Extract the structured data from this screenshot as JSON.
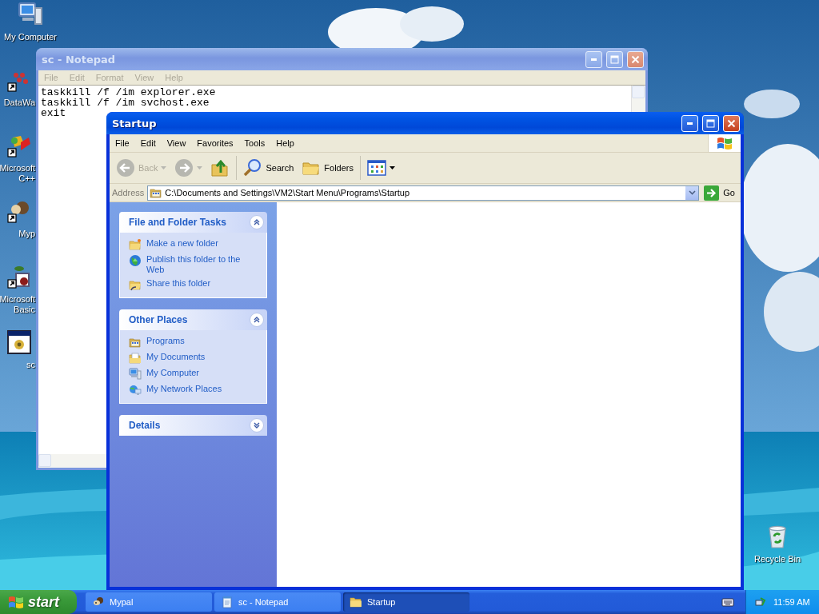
{
  "desktop_icons": [
    {
      "kind": "computer",
      "lines": [
        "My Computer"
      ]
    },
    {
      "kind": "app",
      "lines": [
        "DataWa"
      ]
    },
    {
      "kind": "ide",
      "lines": [
        "Microsoft",
        "C++"
      ]
    },
    {
      "kind": "browser",
      "lines": [
        "Myp"
      ]
    },
    {
      "kind": "basic",
      "lines": [
        "Microsoft",
        "Basic"
      ]
    },
    {
      "kind": "script",
      "lines": [
        "sc"
      ]
    }
  ],
  "recycle_bin": {
    "label": "Recycle Bin"
  },
  "notepad": {
    "title": "sc - Notepad",
    "active": false,
    "menu": [
      "File",
      "Edit",
      "Format",
      "View",
      "Help"
    ],
    "lines": [
      "taskkill /f /im explorer.exe",
      "taskkill /f /im svchost.exe",
      "exit"
    ]
  },
  "explorer": {
    "title": "Startup",
    "active": true,
    "menu": [
      "File",
      "Edit",
      "View",
      "Favorites",
      "Tools",
      "Help"
    ],
    "toolbar": [
      {
        "kind": "back",
        "label": "Back",
        "disabled": true,
        "dropdown": true
      },
      {
        "kind": "forward",
        "disabled": true,
        "dropdown": true
      },
      {
        "kind": "up",
        "disabled": false,
        "dropdown": false
      },
      {
        "kind": "search",
        "label": "Search",
        "disabled": false,
        "dropdown": false
      },
      {
        "kind": "folders",
        "label": "Folders",
        "disabled": false,
        "dropdown": false
      },
      {
        "kind": "views",
        "disabled": false,
        "dropdown": true
      }
    ],
    "address_label": "Address",
    "address": "C:\\Documents and Settings\\VM2\\Start Menu\\Programs\\Startup",
    "go": "Go",
    "panels": [
      {
        "title": "File and Folder Tasks",
        "expanded": true,
        "items": [
          {
            "kind": "new-folder",
            "label": "Make a new folder"
          },
          {
            "kind": "globe",
            "label": "Publish this folder to the Web"
          },
          {
            "kind": "share",
            "label": "Share this folder"
          }
        ]
      },
      {
        "title": "Other Places",
        "expanded": true,
        "items": [
          {
            "kind": "programs",
            "label": "Programs"
          },
          {
            "kind": "documents",
            "label": "My Documents"
          },
          {
            "kind": "computer",
            "label": "My Computer"
          },
          {
            "kind": "network",
            "label": "My Network Places"
          }
        ]
      },
      {
        "title": "Details",
        "expanded": false
      }
    ]
  },
  "taskbar": {
    "start": "start",
    "tasks": [
      {
        "kind": "browser",
        "label": "Mypal",
        "selected": false
      },
      {
        "kind": "notepad",
        "label": "sc - Notepad",
        "selected": false
      },
      {
        "kind": "folder",
        "label": "Startup",
        "selected": true
      }
    ],
    "clock": "11:59 AM"
  }
}
